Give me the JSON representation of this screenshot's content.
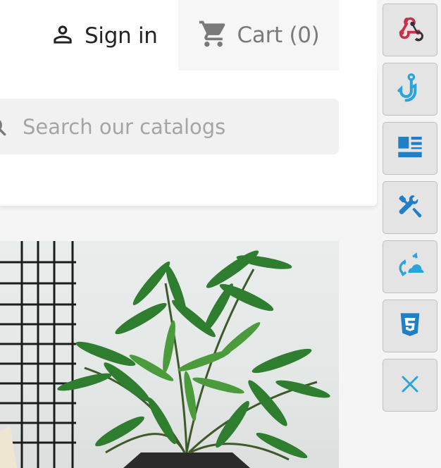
{
  "header": {
    "signin_label": "Sign in",
    "cart_label": "Cart",
    "cart_count": "(0)"
  },
  "search": {
    "placeholder": "Search our catalogs"
  },
  "product": {
    "image_icon": "plant-photo"
  },
  "toolbar": {
    "buttons": [
      {
        "icon": "webhook-icon",
        "color": "#c6304a"
      },
      {
        "icon": "hook-icon",
        "color": "#2aa4dd"
      },
      {
        "icon": "layout-icon",
        "color": "#1f7fc7"
      },
      {
        "icon": "tools-icon",
        "color": "#1f7fc7"
      },
      {
        "icon": "cloud-sync-icon",
        "color": "#2aa4dd"
      },
      {
        "icon": "css3-icon",
        "color": "#1f7fc7"
      },
      {
        "icon": "close-icon",
        "color": "#2aa4dd"
      }
    ]
  },
  "colors": {
    "text_dark": "#232323",
    "text_muted": "#7a7a7a",
    "placeholder": "#a5a5a5",
    "toolbar_bg": "#e4e4e4"
  }
}
